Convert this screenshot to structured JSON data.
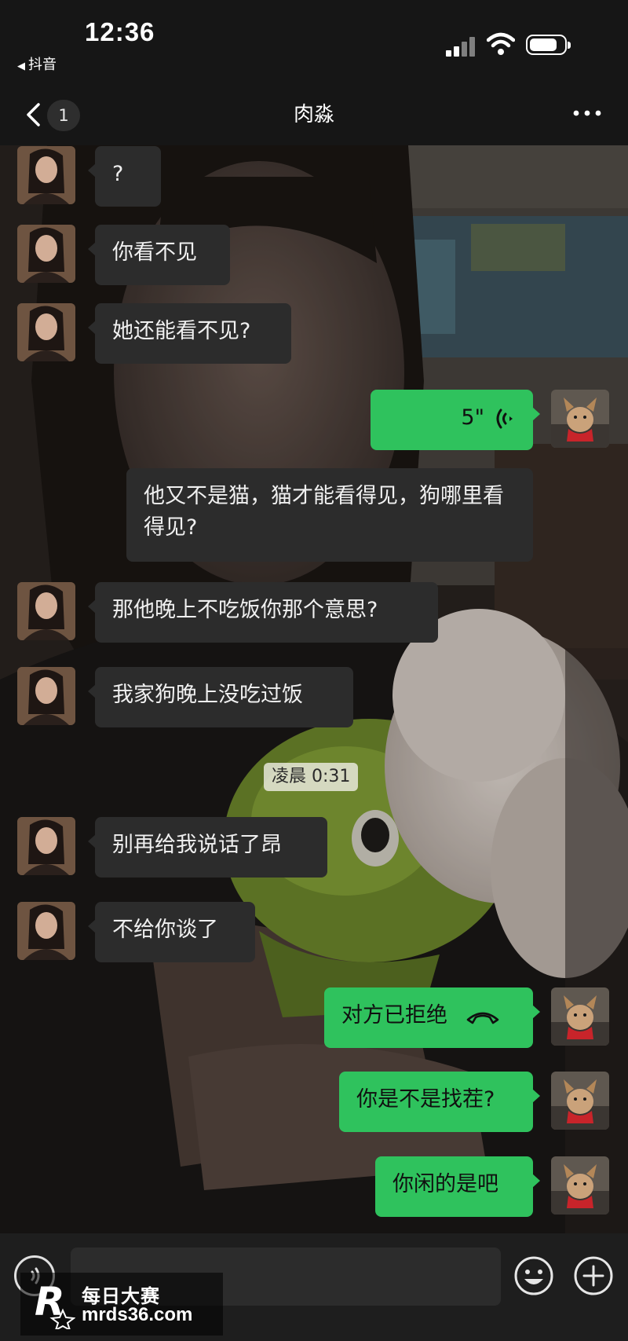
{
  "status_bar": {
    "time": "12:36",
    "back_app": "抖音"
  },
  "nav": {
    "unread_count": "1",
    "title": "肉淼"
  },
  "messages": [
    {
      "side": "in",
      "text": "?"
    },
    {
      "side": "in",
      "text": "你看不见"
    },
    {
      "side": "in",
      "text": "她还能看不见?"
    },
    {
      "side": "out",
      "type": "voice",
      "duration": "5\""
    },
    {
      "side": "in",
      "text": "他又不是猫，猫才能看得见，狗哪里看得见?"
    },
    {
      "side": "in",
      "text": "那他晚上不吃饭你那个意思?"
    },
    {
      "side": "in",
      "text": "我家狗晚上没吃过饭"
    },
    {
      "side": "in",
      "text": "别再给我说话了昂"
    },
    {
      "side": "in",
      "text": "不给你谈了"
    },
    {
      "side": "out",
      "type": "call",
      "text": "对方已拒绝"
    },
    {
      "side": "out",
      "text": "你是不是找茬?"
    },
    {
      "side": "out",
      "text": "你闲的是吧"
    }
  ],
  "timestamp": "凌晨 0:31",
  "input": {
    "value": ""
  },
  "watermark": {
    "name": "每日大赛",
    "url": "mrds36.com",
    "logo_letter": "R"
  },
  "colors": {
    "outgoing_bubble": "#2fc25d",
    "incoming_bubble": "#2c2c2c",
    "background": "#161616"
  }
}
